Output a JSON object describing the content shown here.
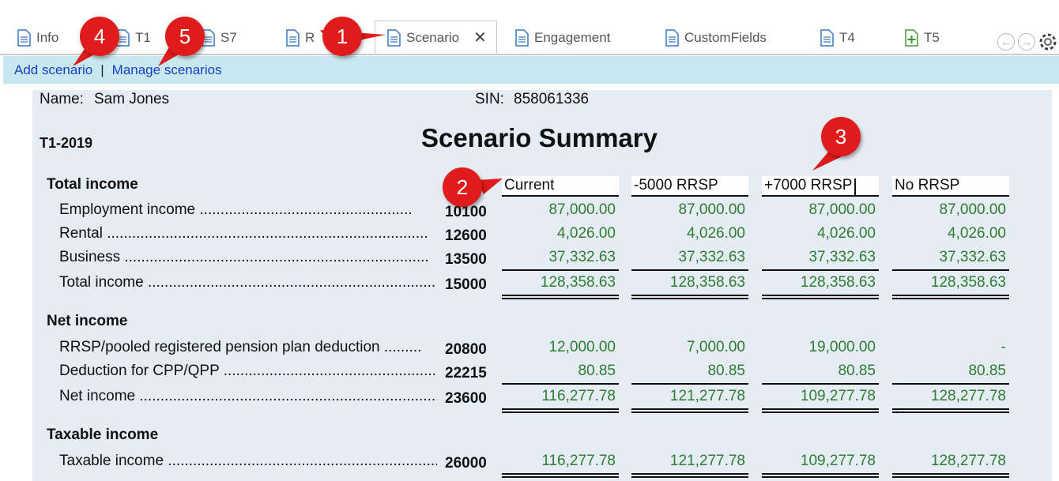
{
  "tabs": [
    {
      "label": "Info"
    },
    {
      "label": "T1"
    },
    {
      "label": "S7"
    },
    {
      "label": "R"
    },
    {
      "label": "Scenario",
      "close": "✕"
    },
    {
      "label": "Engagement"
    },
    {
      "label": "CustomFields"
    },
    {
      "label": "T4"
    },
    {
      "label": "T5"
    }
  ],
  "nav": {
    "back": "←",
    "forward": "→"
  },
  "links": {
    "add": "Add scenario",
    "separator": "|",
    "manage": "Manage scenarios"
  },
  "client": {
    "name_label": "Name:",
    "name": "Sam Jones",
    "sin_label": "SIN:",
    "sin": "858061336"
  },
  "return_year": "T1-2019",
  "title": "Scenario Summary",
  "scenarios": [
    "Current",
    "-5000 RRSP",
    "+7000 RRSP",
    "No RRSP"
  ],
  "sections": {
    "total_income": "Total income",
    "net_income": "Net income",
    "taxable_income": "Taxable income"
  },
  "rows": [
    {
      "label": "Employment income ...................................................",
      "code": "10100",
      "values": [
        "87,000.00",
        "87,000.00",
        "87,000.00",
        "87,000.00"
      ]
    },
    {
      "label": "Rental .............................................................................",
      "code": "12600",
      "values": [
        "4,026.00",
        "4,026.00",
        "4,026.00",
        "4,026.00"
      ]
    },
    {
      "label": "Business .........................................................................",
      "code": "13500",
      "values": [
        "37,332.63",
        "37,332.63",
        "37,332.63",
        "37,332.63"
      ]
    },
    {
      "label": "Total income .....................................................................",
      "code": "15000",
      "values": [
        "128,358.63",
        "128,358.63",
        "128,358.63",
        "128,358.63"
      ]
    },
    {
      "label": "RRSP/pooled registered pension plan deduction ..........",
      "code": "20800",
      "values": [
        "12,000.00",
        "7,000.00",
        "19,000.00",
        "-"
      ]
    },
    {
      "label": "Deduction for CPP/QPP ............................................................",
      "code": "22215",
      "values": [
        "80.85",
        "80.85",
        "80.85",
        "80.85"
      ]
    },
    {
      "label": "Net income ..........................................................................",
      "code": "23600",
      "values": [
        "116,277.78",
        "121,277.78",
        "109,277.78",
        "128,277.78"
      ]
    },
    {
      "label": "Taxable income ...................................................................",
      "code": "26000",
      "values": [
        "116,277.78",
        "121,277.78",
        "109,277.78",
        "128,277.78"
      ]
    }
  ],
  "callouts": [
    "1",
    "2",
    "3",
    "4",
    "5"
  ],
  "colors": {
    "accent_link": "#1a3ec8",
    "value_green": "#2e7d32",
    "callout_red": "#e01b1b",
    "linkbar_bg": "#c8e8f0",
    "form_bg": "#e6ecf4"
  }
}
